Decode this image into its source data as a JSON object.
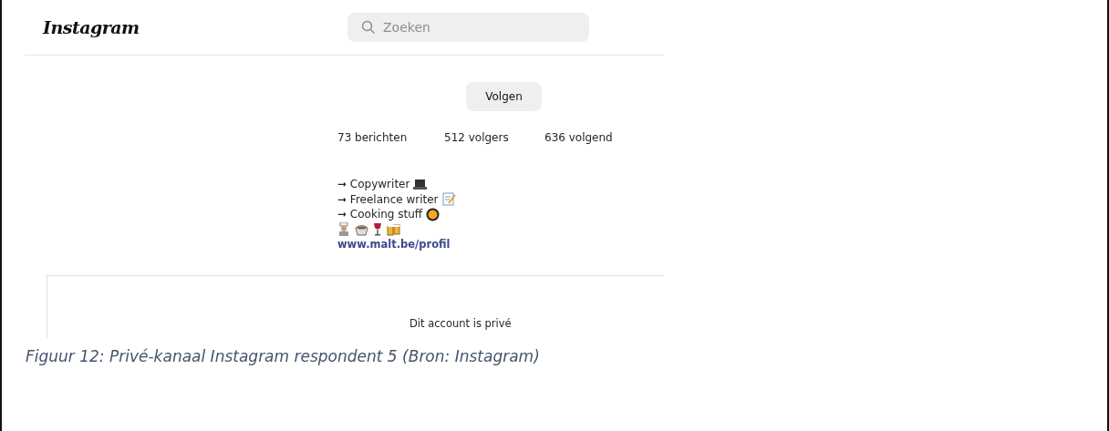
{
  "header": {
    "logo": "Instagram",
    "search": {
      "placeholder": "Zoeken"
    }
  },
  "profile": {
    "follow_button": "Volgen",
    "stats": [
      "73 berichten",
      "512 volgers",
      "636 volgend"
    ],
    "bio": [
      "➞ Copywriter",
      "➞ Freelance writer",
      "➞ Cooking stuff"
    ],
    "link": "www.malt.be/profil"
  },
  "private_notice": "Dit account is privé",
  "caption": "Figuur 12: Privé-kanaal Instagram respondent 5 (Bron: Instagram)"
}
